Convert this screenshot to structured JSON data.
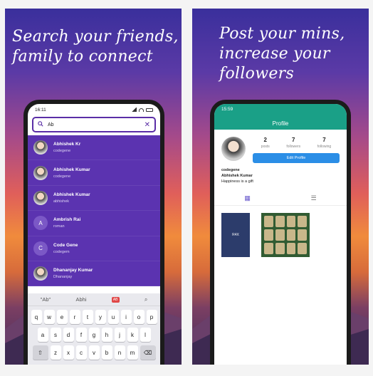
{
  "left": {
    "headline": [
      "Search your friends,",
      "family to connect"
    ],
    "status_time": "16:11",
    "search": {
      "value": "Ab",
      "close_glyph": "✕"
    },
    "results": [
      {
        "name": "Abhishek Kr",
        "sub": "codegene",
        "avatar": "image"
      },
      {
        "name": "Abhishek Kumar",
        "sub": "codegene",
        "avatar": "image"
      },
      {
        "name": "Abhishek Kumar",
        "sub": "abhishek",
        "avatar": "image"
      },
      {
        "name": "Ambrish Rai",
        "sub": "roman",
        "avatar": "A"
      },
      {
        "name": "Code Gene",
        "sub": "codegem",
        "avatar": "C"
      },
      {
        "name": "Dhananjay Kumar",
        "sub": "Dhananjay",
        "avatar": "image"
      }
    ],
    "keyboard": {
      "suggestions": [
        "\"Ab\"",
        "Abhi",
        "AB"
      ],
      "rows": [
        [
          "q",
          "w",
          "e",
          "r",
          "t",
          "y",
          "u",
          "i",
          "o",
          "p"
        ],
        [
          "a",
          "s",
          "d",
          "f",
          "g",
          "h",
          "j",
          "k",
          "l"
        ],
        [
          "⇧",
          "z",
          "x",
          "c",
          "v",
          "b",
          "n",
          "m",
          "⌫"
        ]
      ]
    }
  },
  "right": {
    "headline": [
      "Post your mins,",
      "increase your",
      "followers"
    ],
    "status_time": "15:59",
    "title": "Profile",
    "stats": [
      {
        "value": "2",
        "label": "posts"
      },
      {
        "value": "7",
        "label": "followers"
      },
      {
        "value": "7",
        "label": "following"
      }
    ],
    "edit_button": "Edit Profile",
    "username": "codegene",
    "full_name": "Abhishek Kumar",
    "bio": "Happiness is a gift",
    "post1_text": "R4X"
  },
  "colors": {
    "accent": "#5b33b0",
    "profile_bar": "#1aa087",
    "button": "#2b8ee6"
  }
}
